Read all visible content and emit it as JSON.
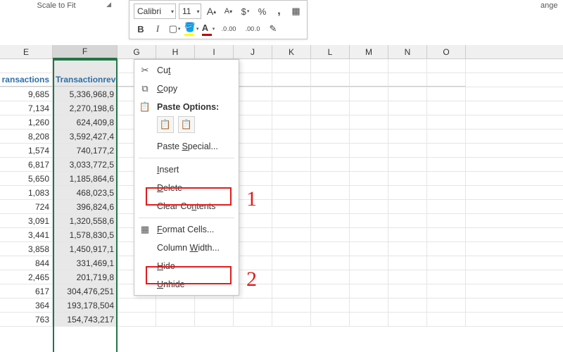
{
  "ribbon": {
    "group_label": "Scale to Fit",
    "partial_group_label": "ange"
  },
  "mini_toolbar": {
    "font_name": "Calibri",
    "font_size": "11",
    "increase_font": "A",
    "decrease_font": "A",
    "currency": "$",
    "percent": "%",
    "comma": ",",
    "bold": "B",
    "italic": "I",
    "fill_color": "#ffff00",
    "font_color": "#c00000",
    "merge_icon": "▦",
    "decimals_inc": ".0 .00",
    "decimals_dec": ".00 .0",
    "format_painter": "✎"
  },
  "columns": {
    "labels": [
      "E",
      "F",
      "G",
      "H",
      "I",
      "J",
      "K",
      "L",
      "M",
      "N",
      "O"
    ]
  },
  "headers": {
    "col_e": "ransactions",
    "col_f": "Transactionreve"
  },
  "context_menu": {
    "cut": "Cut",
    "copy": "Copy",
    "paste_options": "Paste Options:",
    "paste_special": "Paste Special...",
    "insert": "Insert",
    "delete": "Delete",
    "clear_contents": "Clear Contents",
    "format_cells": "Format Cells...",
    "column_width": "Column Width...",
    "hide": "Hide",
    "unhide": "Unhide"
  },
  "annotations": {
    "box1_target": "Delete",
    "num1": "1",
    "box2_target": "Hide",
    "num2": "2"
  },
  "data_rows": [
    {
      "e": "9,685",
      "f": "5,336,968,9"
    },
    {
      "e": "7,134",
      "f": "2,270,198,6"
    },
    {
      "e": "1,260",
      "f": "624,409,8"
    },
    {
      "e": "8,208",
      "f": "3,592,427,4"
    },
    {
      "e": "1,574",
      "f": "740,177,2"
    },
    {
      "e": "6,817",
      "f": "3,033,772,5"
    },
    {
      "e": "5,650",
      "f": "1,185,864,6"
    },
    {
      "e": "1,083",
      "f": "468,023,5"
    },
    {
      "e": "724",
      "f": "396,824,6"
    },
    {
      "e": "3,091",
      "f": "1,320,558,6"
    },
    {
      "e": "3,441",
      "f": "1,578,830,5"
    },
    {
      "e": "3,858",
      "f": "1,450,917,1"
    },
    {
      "e": "844",
      "f": "331,469,1"
    },
    {
      "e": "2,465",
      "f": "201,719,8"
    },
    {
      "e": "617",
      "f": "304,476,251"
    },
    {
      "e": "364",
      "f": "193,178,504"
    },
    {
      "e": "763",
      "f": "154,743,217"
    }
  ]
}
